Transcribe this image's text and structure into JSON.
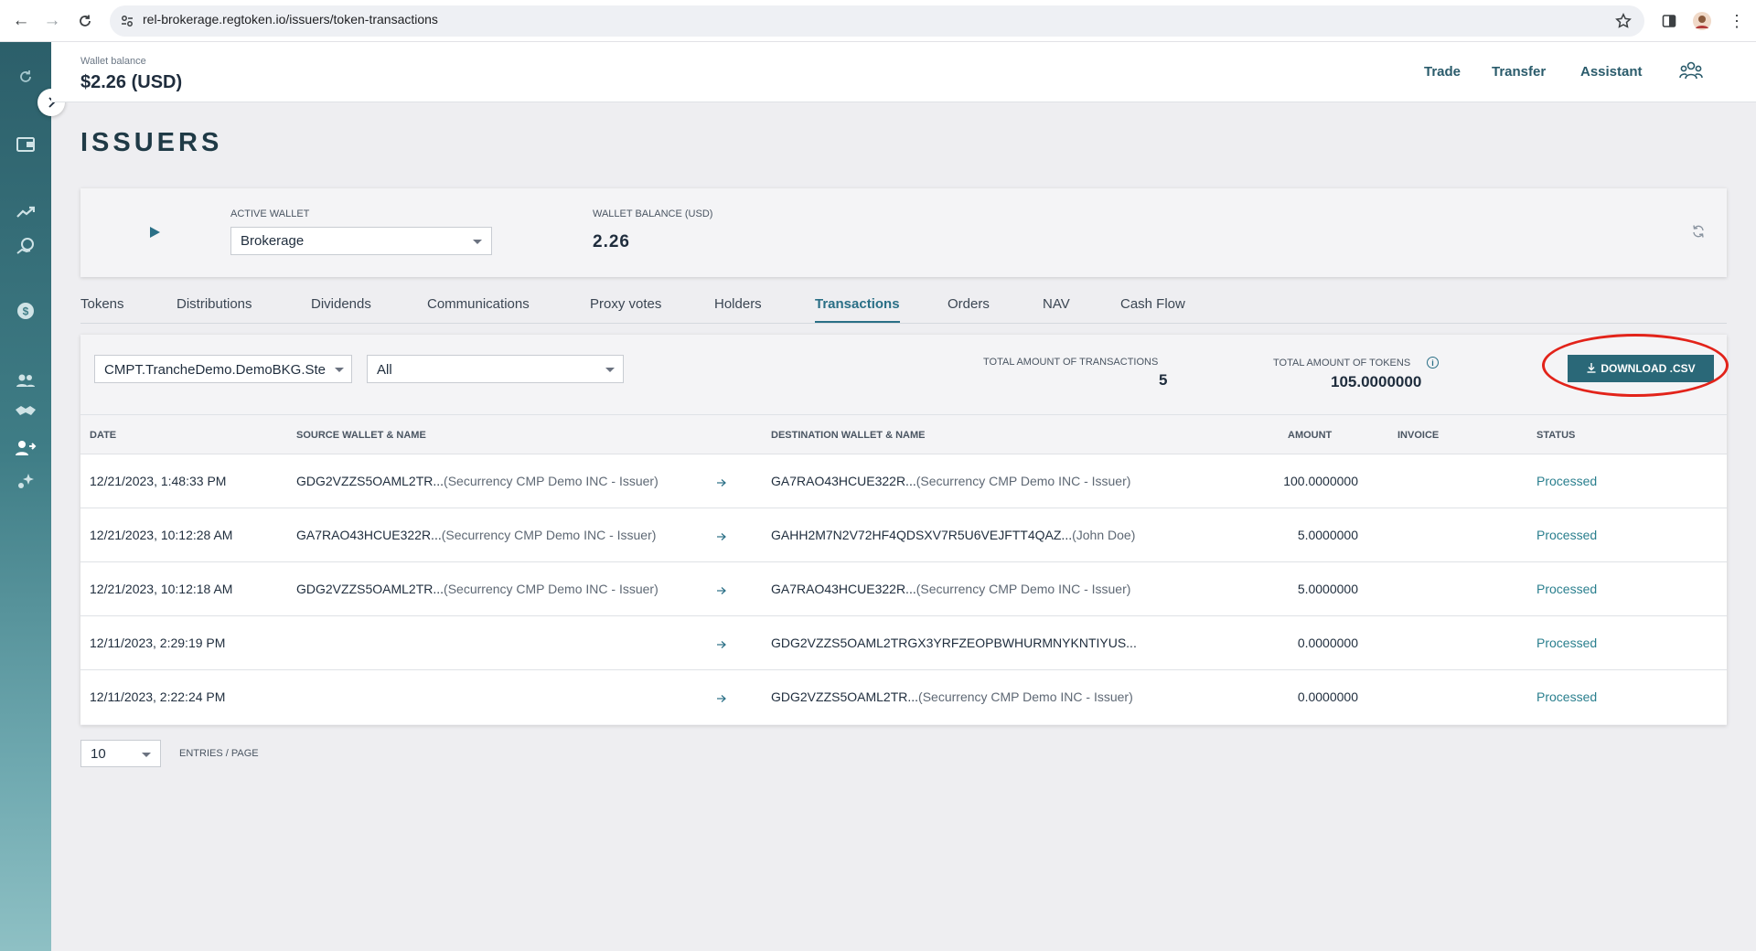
{
  "browser": {
    "url": "rel-brokerage.regtoken.io/issuers/token-transactions"
  },
  "sidebar": {
    "items": [
      {
        "icon": "refresh-icon"
      },
      {
        "icon": "wallet-icon"
      },
      {
        "icon": "trend-icon"
      },
      {
        "icon": "coin-hand-icon"
      },
      {
        "icon": "dollar-icon"
      },
      {
        "icon": "users-icon"
      },
      {
        "icon": "handshake-icon"
      },
      {
        "icon": "user-transfer-icon"
      },
      {
        "icon": "sparkle-icon"
      }
    ]
  },
  "header": {
    "wallet_balance_label": "Wallet balance",
    "wallet_balance_value": "$2.26 (USD)",
    "links": [
      "Trade",
      "Transfer",
      "Assistant"
    ]
  },
  "page": {
    "title": "ISSUERS"
  },
  "wallet_card": {
    "active_wallet_label": "ACTIVE WALLET",
    "active_wallet_value": "Brokerage",
    "balance_label": "WALLET BALANCE (USD)",
    "balance_value": "2.26"
  },
  "tabs": [
    "Tokens",
    "Distributions",
    "Dividends",
    "Communications",
    "Proxy votes",
    "Holders",
    "Transactions",
    "Orders",
    "NAV",
    "Cash Flow"
  ],
  "active_tab": "Transactions",
  "filters": {
    "token_select": "CMPT.TrancheDemo.DemoBKG.Ste",
    "type_select": "All"
  },
  "stats": {
    "total_transactions_label": "TOTAL AMOUNT OF TRANSACTIONS",
    "total_transactions_value": "5",
    "total_tokens_label": "TOTAL AMOUNT OF TOKENS",
    "total_tokens_value": "105.0000000"
  },
  "download_button": "DOWNLOAD .CSV",
  "table": {
    "columns": [
      "DATE",
      "SOURCE WALLET & NAME",
      "DESTINATION WALLET & NAME",
      "AMOUNT",
      "INVOICE",
      "STATUS"
    ],
    "rows": [
      {
        "date": "12/21/2023, 1:48:33 PM",
        "source_wallet": "GDG2VZZS5OAML2TR...",
        "source_name": "(Securrency CMP Demo INC - Issuer)",
        "dest_wallet": "GA7RAO43HCUE322R...",
        "dest_name": "(Securrency CMP Demo INC - Issuer)",
        "amount": "100.0000000",
        "invoice": "",
        "status": "Processed"
      },
      {
        "date": "12/21/2023, 10:12:28 AM",
        "source_wallet": "GA7RAO43HCUE322R...",
        "source_name": "(Securrency CMP Demo INC - Issuer)",
        "dest_wallet": "GAHH2M7N2V72HF4QDSXV7R5U6VEJFTT4QAZ...",
        "dest_name": "(John Doe)",
        "amount": "5.0000000",
        "invoice": "",
        "status": "Processed"
      },
      {
        "date": "12/21/2023, 10:12:18 AM",
        "source_wallet": "GDG2VZZS5OAML2TR...",
        "source_name": "(Securrency CMP Demo INC - Issuer)",
        "dest_wallet": "GA7RAO43HCUE322R...",
        "dest_name": "(Securrency CMP Demo INC - Issuer)",
        "amount": "5.0000000",
        "invoice": "",
        "status": "Processed"
      },
      {
        "date": "12/11/2023, 2:29:19 PM",
        "source_wallet": "",
        "source_name": "",
        "dest_wallet": "GDG2VZZS5OAML2TRGX3YRFZEOPBWHURMNYKNTIYUS...",
        "dest_name": "",
        "amount": "0.0000000",
        "invoice": "",
        "status": "Processed"
      },
      {
        "date": "12/11/2023, 2:22:24 PM",
        "source_wallet": "",
        "source_name": "",
        "dest_wallet": "GDG2VZZS5OAML2TR...",
        "dest_name": "(Securrency CMP Demo INC - Issuer)",
        "amount": "0.0000000",
        "invoice": "",
        "status": "Processed"
      }
    ]
  },
  "pagination": {
    "page_size": "10",
    "entries_label": "ENTRIES / PAGE"
  },
  "colors": {
    "accent": "#2a6f86",
    "button": "#2a6878",
    "highlight": "#e2231a"
  }
}
